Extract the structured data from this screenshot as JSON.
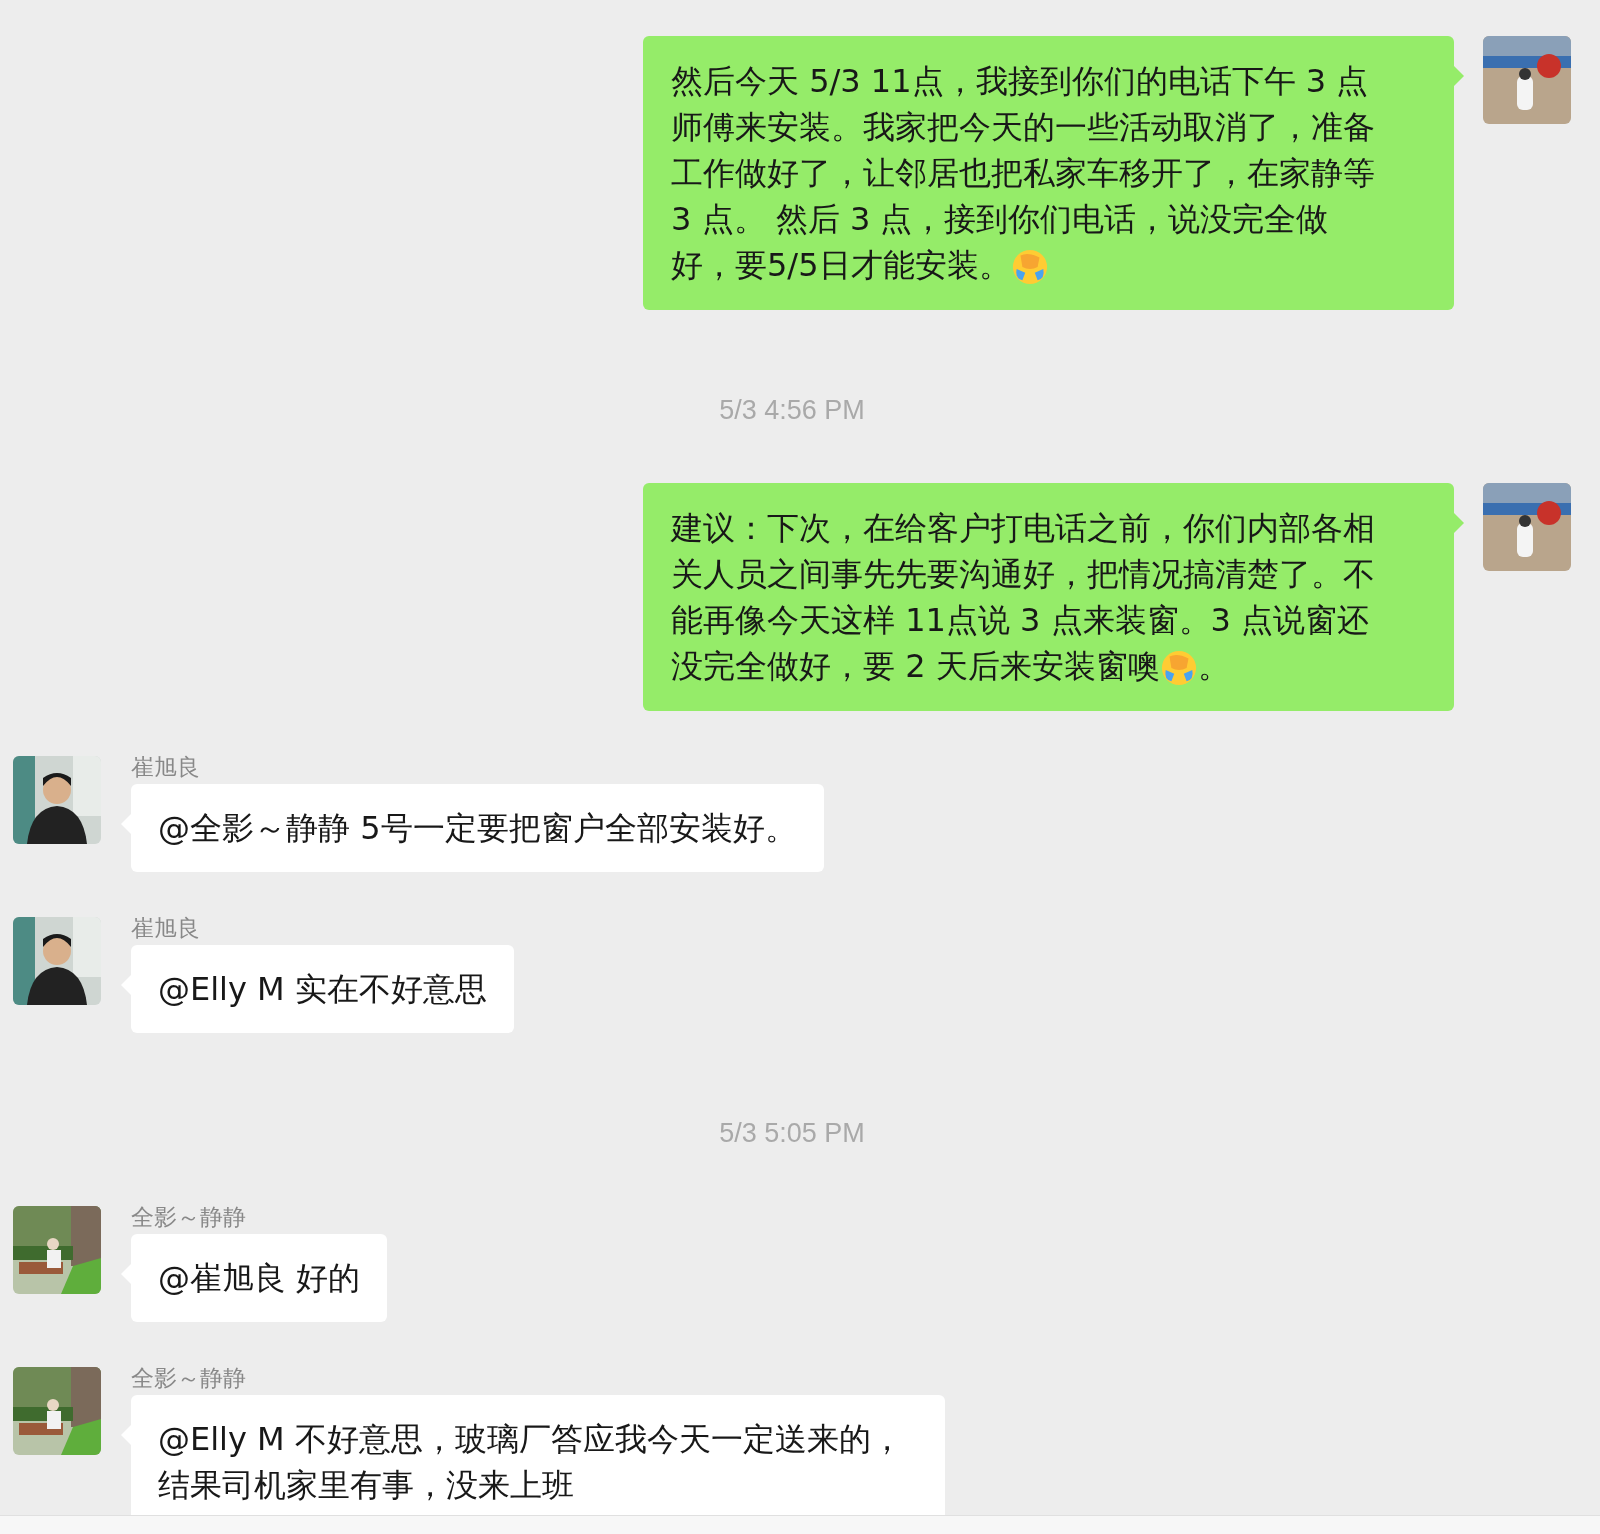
{
  "messages": [
    {
      "kind": "sent",
      "parts": [
        {
          "kind": "text",
          "text": "然后今天 5/3  11点，我接到你们的电话下午 3 点师傅来安装。我家把今天的一些活动取消了，准备工作做好了，让邻居也把私家车移开了，在家静等 3 点。 然后 3 点，接到你们电话，说没完全做好，要5/5日才能安装。"
        },
        {
          "kind": "emoji"
        }
      ]
    },
    {
      "kind": "time",
      "text": "5/3 4:56 PM"
    },
    {
      "kind": "sent",
      "parts": [
        {
          "kind": "text",
          "text": "建议：下次，在给客户打电话之前，你们内部各相关人员之间事先先要沟通好，把情况搞清楚了。不能再像今天这样 11点说 3 点来装窗。3 点说窗还没完全做好，要 2 天后来安装窗噢"
        },
        {
          "kind": "emoji"
        },
        {
          "kind": "text",
          "text": "。"
        }
      ]
    },
    {
      "kind": "received",
      "sender": "崔旭良",
      "parts": [
        {
          "kind": "text",
          "text": "@全影～静静 5号一定要把窗户全部安装好。"
        }
      ]
    },
    {
      "kind": "received",
      "sender": "崔旭良",
      "parts": [
        {
          "kind": "text",
          "text": "@Elly M 实在不好意思"
        }
      ]
    },
    {
      "kind": "time",
      "text": "5/3 5:05 PM"
    },
    {
      "kind": "received",
      "sender": "全影～静静",
      "parts": [
        {
          "kind": "text",
          "text": "@崔旭良 好的"
        }
      ]
    },
    {
      "kind": "received",
      "sender": "全影～静静",
      "parts": [
        {
          "kind": "text",
          "text": "@Elly M 不好意思，玻璃厂答应我今天一定送来的，结果司机家里有事，没来上班"
        }
      ]
    }
  ]
}
